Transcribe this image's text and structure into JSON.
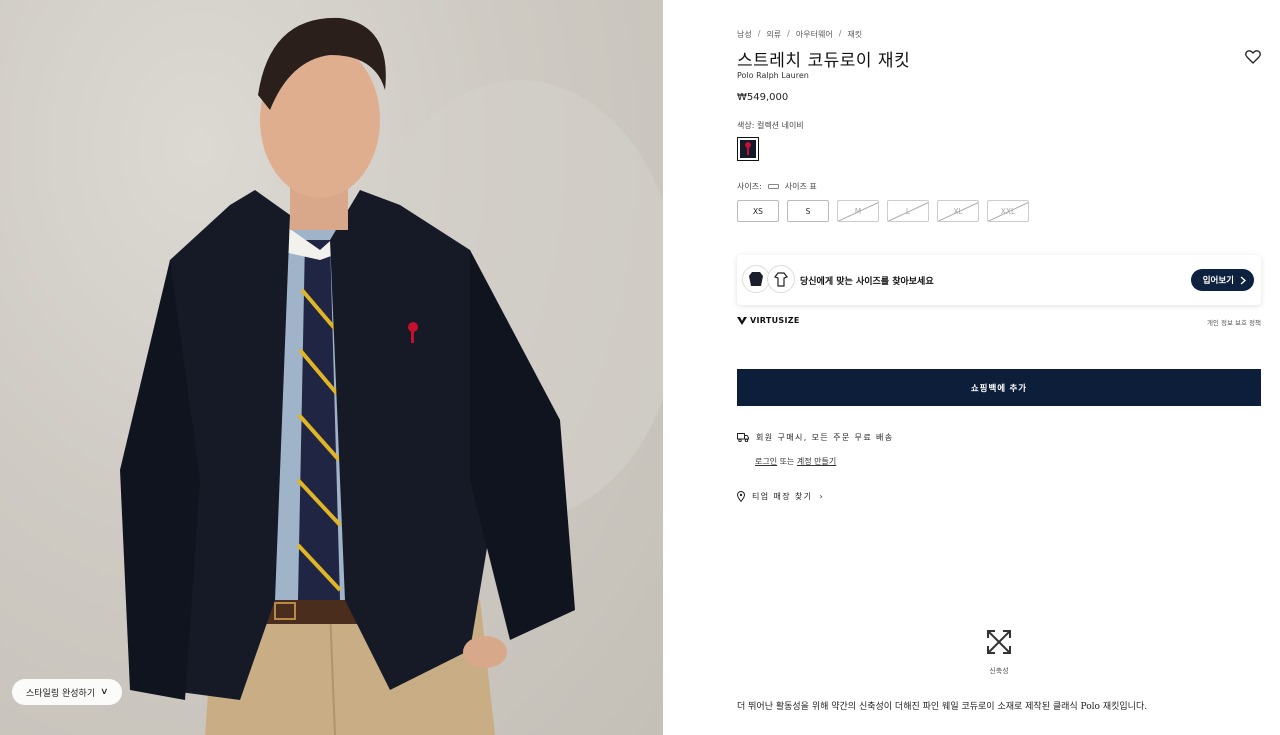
{
  "photo": {
    "style_pill_label": "스타일링 완성하기",
    "style_pill_chevron": "∨"
  },
  "product": {
    "breadcrumb": [
      "남성",
      "의류",
      "아우터웨어",
      "재킷"
    ],
    "breadcrumb_separator": "/",
    "title": "스트레치 코듀로이 재킷",
    "brand": "Polo Ralph Lauren",
    "price": "₩549,000",
    "color_label": "색상: 컬렉션 네이비",
    "color_swatch_hex": "#121a2c",
    "size_label": "사이즈:",
    "size_chart_label": "사이즈 표",
    "sizes": [
      {
        "label": "XS",
        "available": true
      },
      {
        "label": "S",
        "available": true
      },
      {
        "label": "M",
        "available": false
      },
      {
        "label": "L",
        "available": false
      },
      {
        "label": "XL",
        "available": false
      },
      {
        "label": "XXL",
        "available": false
      }
    ]
  },
  "virtusize": {
    "prompt": "당신에게 맞는 사이즈를 찾아보세요",
    "button_label": "입어보기",
    "brand": "VIRTUSIZE",
    "privacy": "개인 정보 보호 정책"
  },
  "actions": {
    "add_to_bag": "쇼핑백에 추가"
  },
  "shipping": {
    "free_shipping": "회원 구매시, 모든 주문 무료 배송",
    "login": "로그인",
    "or": " 또는 ",
    "create_account": "계정 만들기",
    "find_store": "티업 매장 찾기",
    "find_store_chevron": "›"
  },
  "feature": {
    "label": "신축성"
  },
  "description": "더 뛰어난 활동성을 위해 약간의 신축성이 더해진 파인 웨일 코듀로이 소재로 제작된 클래식 Polo 재킷입니다.",
  "colors": {
    "navy": "#0c1e3a",
    "polo_red": "#c8102e"
  }
}
